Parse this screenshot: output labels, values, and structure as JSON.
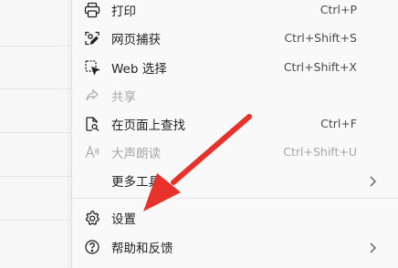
{
  "menu": {
    "items": [
      {
        "label": "打印",
        "shortcut": "Ctrl+P",
        "icon": "printer-icon"
      },
      {
        "label": "网页捕获",
        "shortcut": "Ctrl+Shift+S",
        "icon": "web-capture-icon"
      },
      {
        "label": "Web 选择",
        "shortcut": "Ctrl+Shift+X",
        "icon": "web-select-icon"
      },
      {
        "label": "共享",
        "shortcut": "",
        "icon": "share-icon",
        "disabled": true
      },
      {
        "label": "在页面上查找",
        "shortcut": "Ctrl+F",
        "icon": "find-icon"
      },
      {
        "label": "大声朗读",
        "shortcut": "Ctrl+Shift+U",
        "icon": "read-aloud-icon",
        "disabled": true
      },
      {
        "label": "更多工具",
        "shortcut": "",
        "icon": "",
        "submenu": true
      },
      {
        "label": "设置",
        "shortcut": "",
        "icon": "gear-icon"
      },
      {
        "label": "帮助和反馈",
        "shortcut": "",
        "icon": "help-icon",
        "submenu": true
      }
    ]
  },
  "annotation": {
    "arrow_color": "#e8312b"
  }
}
